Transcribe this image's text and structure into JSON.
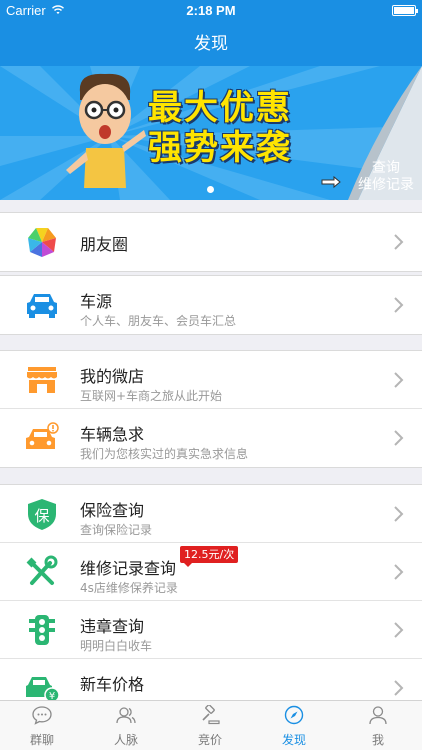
{
  "status": {
    "carrier": "Carrier",
    "time": "2:18 PM"
  },
  "nav": {
    "title": "发现"
  },
  "banner": {
    "headline_line1": "最大优惠",
    "headline_line2": "强势来袭",
    "query_line1": "查询",
    "query_line2": "维修记录"
  },
  "sections": [
    {
      "rows": [
        {
          "title": "朋友圈",
          "subtitle": "",
          "icon": "moments-icon"
        }
      ]
    },
    {
      "rows": [
        {
          "title": "车源",
          "subtitle": "个人车、朋友车、会员车汇总",
          "icon": "car-icon"
        }
      ]
    },
    {
      "rows": [
        {
          "title": "我的微店",
          "subtitle": "互联网+车商之旅从此开始",
          "icon": "store-icon"
        },
        {
          "title": "车辆急求",
          "subtitle": "我们为您核实过的真实急求信息",
          "icon": "car-urgent-icon"
        }
      ]
    },
    {
      "rows": [
        {
          "title": "保险查询",
          "subtitle": "查询保险记录",
          "icon": "insurance-shield-icon"
        },
        {
          "title": "维修记录查询",
          "subtitle": "4s店维修保养记录",
          "badge": "12.5元/次",
          "icon": "repair-tools-icon"
        },
        {
          "title": "违章查询",
          "subtitle": "明明白白收车",
          "icon": "traffic-light-icon"
        },
        {
          "title": "新车价格",
          "subtitle": "",
          "icon": "new-car-price-icon"
        }
      ]
    }
  ],
  "tabs": [
    {
      "label": "群聊",
      "icon": "chat-icon"
    },
    {
      "label": "人脉",
      "icon": "contacts-icon"
    },
    {
      "label": "竞价",
      "icon": "auction-hammer-icon"
    },
    {
      "label": "发现",
      "icon": "compass-icon",
      "active": true
    },
    {
      "label": "我",
      "icon": "profile-icon"
    }
  ],
  "colors": {
    "brand_blue": "#1a8fe3",
    "banner_yellow": "#ffe400",
    "badge_red": "#e02020",
    "icon_green": "#2bb673",
    "icon_orange": "#ff9a2e"
  }
}
